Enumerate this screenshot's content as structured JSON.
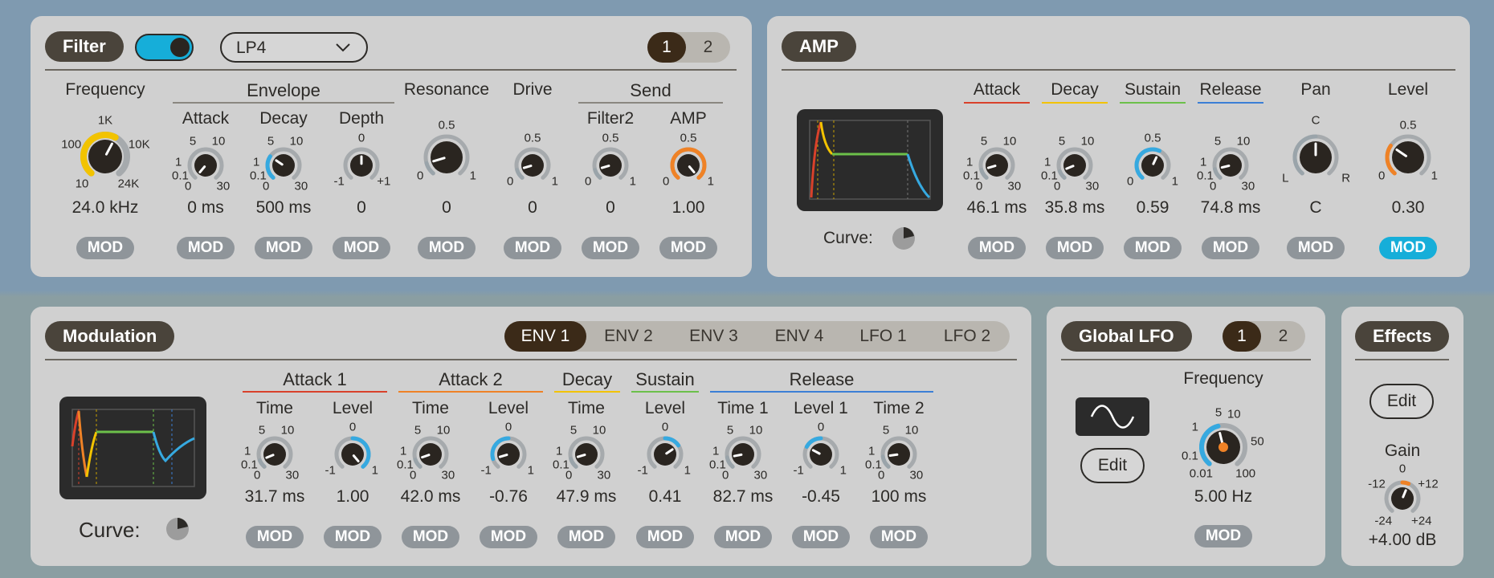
{
  "filter": {
    "title": "Filter",
    "toggle_on": true,
    "filter_type": "LP4",
    "page_buttons": [
      "1",
      "2"
    ],
    "active_page": "1",
    "groups": {
      "envelope": "Envelope",
      "send": "Send"
    },
    "knobs": [
      {
        "id": "frequency",
        "label": "Frequency",
        "value": "24.0 kHz",
        "fraction": 0.6,
        "arc_color": "#f2c300",
        "ticks": [
          "10",
          "100",
          "1K",
          "10K",
          "24K"
        ]
      },
      {
        "id": "attack",
        "label": "Attack",
        "value": "0 ms",
        "fraction": 0,
        "arc_color": "#9aa4aa",
        "ticks": [
          "0",
          "0.1",
          "1",
          "5",
          "10",
          "30"
        ]
      },
      {
        "id": "decay",
        "label": "Decay",
        "value": "500 ms",
        "fraction": 0.3,
        "arc_color": "#36a9e0",
        "ticks": [
          "0",
          "0.1",
          "1",
          "5",
          "10",
          "30"
        ]
      },
      {
        "id": "depth",
        "label": "Depth",
        "value": "0",
        "fraction": 0.5,
        "arc_color": "#9aa4aa",
        "ticks": [
          "-1",
          "0",
          "+1"
        ]
      },
      {
        "id": "resonance",
        "label": "Resonance",
        "value": "0",
        "fraction": 0.12,
        "arc_color": "#9aa4aa",
        "ticks": [
          "0",
          "0.5",
          "1"
        ]
      },
      {
        "id": "drive",
        "label": "Drive",
        "value": "0",
        "fraction": 0.12,
        "arc_color": "#9aa4aa",
        "ticks": [
          "0",
          "0.5",
          "1"
        ]
      },
      {
        "id": "filter2",
        "label": "Filter2",
        "value": "0",
        "fraction": 0.12,
        "arc_color": "#9aa4aa",
        "ticks": [
          "0",
          "0.5",
          "1"
        ]
      },
      {
        "id": "amp_send",
        "label": "AMP",
        "value": "1.00",
        "fraction": 1,
        "arc_color": "#ef8226",
        "ticks": [
          "0",
          "0.5",
          "1"
        ]
      }
    ],
    "mod_label": "MOD"
  },
  "amp": {
    "title": "AMP",
    "curve_label": "Curve:",
    "knobs": [
      {
        "id": "attack",
        "label": "Attack",
        "value": "46.1 ms",
        "fraction": 0.12,
        "arc_color": "#9aa4aa",
        "underline": "#d9412b",
        "ticks": [
          "0",
          "0.1",
          "1",
          "5",
          "10",
          "30"
        ]
      },
      {
        "id": "decay",
        "label": "Decay",
        "value": "35.8 ms",
        "fraction": 0.1,
        "arc_color": "#9aa4aa",
        "underline": "#f2c300",
        "ticks": [
          "0",
          "0.1",
          "1",
          "5",
          "10",
          "30"
        ]
      },
      {
        "id": "sustain",
        "label": "Sustain",
        "value": "0.59",
        "fraction": 0.59,
        "arc_color": "#36a9e0",
        "underline": "#6cc04a",
        "ticks": [
          "0",
          "0.5",
          "1"
        ]
      },
      {
        "id": "release",
        "label": "Release",
        "value": "74.8 ms",
        "fraction": 0.13,
        "arc_color": "#9aa4aa",
        "underline": "#3b7fd6",
        "ticks": [
          "0",
          "0.1",
          "1",
          "5",
          "10",
          "30"
        ]
      },
      {
        "id": "pan",
        "label": "Pan",
        "value": "C",
        "fraction": 0.5,
        "arc_color": "#9aa4aa",
        "underline": "",
        "ticks": [
          "L",
          "C",
          "R"
        ]
      },
      {
        "id": "level",
        "label": "Level",
        "value": "0.30",
        "fraction": 0.3,
        "arc_color": "#ef8226",
        "underline": "",
        "ticks": [
          "0",
          "0.5",
          "1"
        ]
      }
    ],
    "mod_label": "MOD",
    "active_mod": "level"
  },
  "modulation": {
    "title": "Modulation",
    "tabs": [
      "ENV 1",
      "ENV 2",
      "ENV 3",
      "ENV 4",
      "LFO 1",
      "LFO 2"
    ],
    "active_tab": "ENV 1",
    "curve_label": "Curve:",
    "groups": [
      {
        "label": "Attack 1",
        "color": "#d9412b"
      },
      {
        "label": "Attack 2",
        "color": "#ef8226"
      },
      {
        "label": "Decay",
        "color": "#f2c300"
      },
      {
        "label": "Sustain",
        "color": "#6cc04a"
      },
      {
        "label": "Release",
        "color": "#3b7fd6"
      }
    ],
    "knobs": [
      {
        "id": "a1_time",
        "label": "Time",
        "value": "31.7 ms",
        "fraction": 0.1,
        "arc_color": "#9aa4aa",
        "ticks": [
          "0",
          "0.1",
          "1",
          "5",
          "10",
          "30"
        ]
      },
      {
        "id": "a1_level",
        "label": "Level",
        "value": "1.00",
        "fraction": 1,
        "arc_color": "#36a9e0",
        "ticks": [
          "-1",
          "0",
          "1"
        ]
      },
      {
        "id": "a2_time",
        "label": "Time",
        "value": "42.0 ms",
        "fraction": 0.11,
        "arc_color": "#9aa4aa",
        "ticks": [
          "0",
          "0.1",
          "1",
          "5",
          "10",
          "30"
        ]
      },
      {
        "id": "a2_level",
        "label": "Level",
        "value": "-0.76",
        "fraction": 0.12,
        "arc_color": "#36a9e0",
        "ticks": [
          "-1",
          "0",
          "1"
        ]
      },
      {
        "id": "d_time",
        "label": "Time",
        "value": "47.9 ms",
        "fraction": 0.12,
        "arc_color": "#9aa4aa",
        "ticks": [
          "0",
          "0.1",
          "1",
          "5",
          "10",
          "30"
        ]
      },
      {
        "id": "s_level",
        "label": "Level",
        "value": "0.41",
        "fraction": 0.7,
        "arc_color": "#36a9e0",
        "ticks": [
          "-1",
          "0",
          "1"
        ]
      },
      {
        "id": "r_time1",
        "label": "Time 1",
        "value": "82.7 ms",
        "fraction": 0.14,
        "arc_color": "#9aa4aa",
        "ticks": [
          "0",
          "0.1",
          "1",
          "5",
          "10",
          "30"
        ]
      },
      {
        "id": "r_level1",
        "label": "Level 1",
        "value": "-0.45",
        "fraction": 0.28,
        "arc_color": "#36a9e0",
        "ticks": [
          "-1",
          "0",
          "1"
        ]
      },
      {
        "id": "r_time2",
        "label": "Time 2",
        "value": "100 ms",
        "fraction": 0.15,
        "arc_color": "#9aa4aa",
        "ticks": [
          "0",
          "0.1",
          "1",
          "5",
          "10",
          "30"
        ]
      }
    ],
    "mod_label": "MOD"
  },
  "global_lfo": {
    "title": "Global LFO",
    "page_buttons": [
      "1",
      "2"
    ],
    "active_page": "1",
    "edit_label": "Edit",
    "knob": {
      "id": "lfo_freq",
      "label": "Frequency",
      "value": "5.00 Hz",
      "fraction": 0.45,
      "arc_color": "#36a9e0",
      "ticks": [
        "0.01",
        "0.1",
        "1",
        "5",
        "10",
        "50",
        "100"
      ]
    },
    "mod_label": "MOD"
  },
  "effects": {
    "title": "Effects",
    "edit_label": "Edit",
    "knob": {
      "id": "gain",
      "label": "Gain",
      "value": "+4.00 dB",
      "fraction": 0.58,
      "arc_color": "#ef8226",
      "ticks": [
        "-24",
        "-12",
        "0",
        "+12",
        "+24"
      ]
    }
  },
  "colors": {
    "attack": "#d9412b",
    "attack2": "#ef8226",
    "decay": "#f2c300",
    "sustain": "#6cc04a",
    "release": "#3b7fd6",
    "accent": "#16aed9"
  },
  "icons": {
    "dropdown": "chevron-down-icon",
    "shape": "sine-wave-icon",
    "curve": "curve-pie-icon"
  }
}
